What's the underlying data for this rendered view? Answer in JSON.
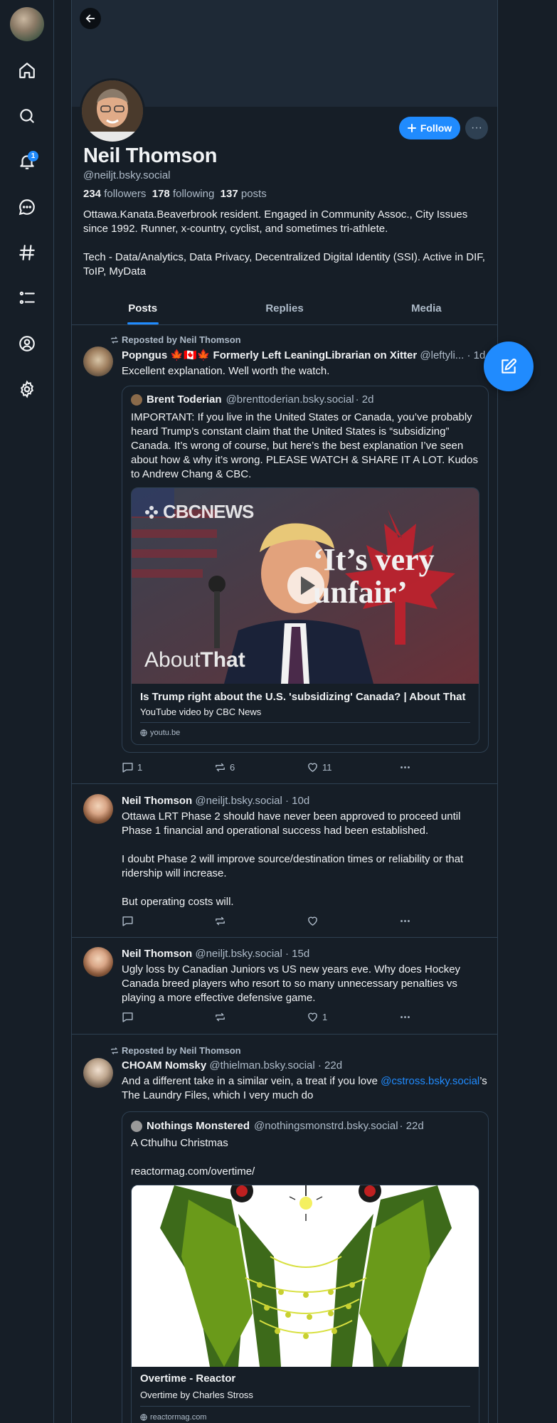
{
  "nav": {
    "notification_count": "1"
  },
  "profile": {
    "display_name": "Neil Thomson",
    "handle": "@neiljt.bsky.social",
    "followers_count": "234",
    "followers_label": "followers",
    "following_count": "178",
    "following_label": "following",
    "posts_count": "137",
    "posts_label": "posts",
    "bio": "Ottawa.Kanata.Beaverbrook resident. Engaged in Community Assoc., City Issues since 1992. Runner, x-country, cyclist, and sometimes tri-athlete.\n\nTech - Data/Analytics, Data Privacy, Decentralized Digital Identity (SSI). Active in DIF, ToIP, MyData",
    "follow_label": "Follow"
  },
  "tabs": [
    {
      "label": "Posts",
      "active": true
    },
    {
      "label": "Replies",
      "active": false
    },
    {
      "label": "Media",
      "active": false
    }
  ],
  "posts": [
    {
      "repost_label": "Reposted by Neil Thomson",
      "author_name": "Popngus 🍁🇨🇦🍁 Formerly Left LeaningLibrarian on Xitter",
      "author_handle": "@leftyli...",
      "time": "· 1d",
      "text": "Excellent explanation. Well worth the watch.",
      "quote": {
        "author_name": "Brent Toderian",
        "author_handle": "@brenttoderian.bsky.social",
        "time": "· 2d",
        "text": "IMPORTANT: If you live in the United States or Canada, you’ve probably heard Trump’s constant claim that the United States is “subsidizing” Canada. It’s wrong of course, but here’s the best explanation I’ve seen about how & why it’s wrong. PLEASE WATCH & SHARE IT A LOT. Kudos to Andrew Chang & CBC.",
        "thumbnail": {
          "brand": "CBCNEWS",
          "quote_line1": "‘It’s very",
          "quote_line2": "unfair’",
          "show_prefix": "About",
          "show_name": "That"
        },
        "embed_title": "Is Trump right about the U.S. 'subsidizing' Canada? | About That",
        "embed_subtitle": "YouTube video by CBC News",
        "embed_domain": "youtu.be"
      },
      "replies": "1",
      "reposts": "6",
      "likes": "11"
    },
    {
      "author_name": "Neil Thomson",
      "author_handle": "@neiljt.bsky.social",
      "time": "· 10d",
      "text": "Ottawa LRT Phase 2 should have never been approved to proceed until Phase 1 financial and operational success had been established.\n\nI doubt Phase 2 will improve source/destination times or reliability or that ridership will increase.\n\nBut operating costs will."
    },
    {
      "author_name": "Neil Thomson",
      "author_handle": "@neiljt.bsky.social",
      "time": "· 15d",
      "text": "Ugly loss by Canadian Juniors vs US new years eve. Why does Hockey Canada breed players who resort to so many unnecessary penalties vs playing a more effective defensive game.",
      "likes": "1"
    },
    {
      "repost_label": "Reposted by Neil Thomson",
      "author_name": "CHOAM Nomsky",
      "author_handle": "@thielman.bsky.social",
      "time": "· 22d",
      "text_before_link": "And a different take in a similar vein, a treat if you love ",
      "link_text": "@cstross.bsky.social",
      "text_after_link": "’s The Laundry Files, which I very much do",
      "quote": {
        "author_name": "Nothings Monstered",
        "author_handle": "@nothingsmonstrd.bsky.social",
        "time": "· 22d",
        "text": "A Cthulhu Christmas\n\nreactormag.com/overtime/",
        "embed_title": "Overtime - Reactor",
        "embed_subtitle": "Overtime by Charles Stross",
        "embed_domain": "reactormag.com"
      }
    }
  ],
  "colors": {
    "background": "#161e27",
    "accent": "#208bfe",
    "border": "#2e4052",
    "muted_text": "#aebbc9"
  }
}
